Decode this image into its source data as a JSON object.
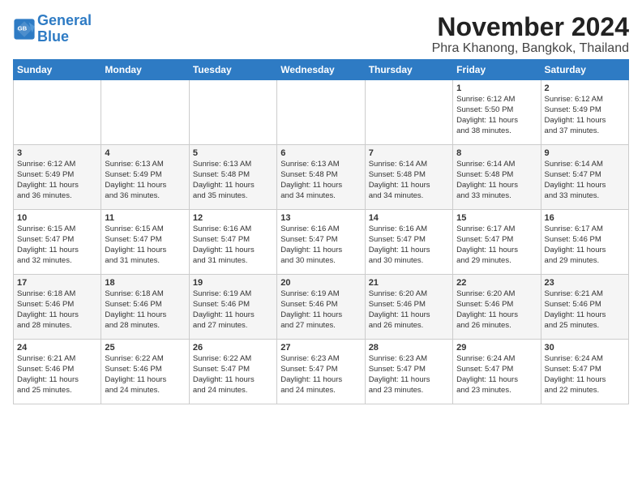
{
  "header": {
    "logo_line1": "General",
    "logo_line2": "Blue",
    "month_title": "November 2024",
    "location": "Phra Khanong, Bangkok, Thailand"
  },
  "weekdays": [
    "Sunday",
    "Monday",
    "Tuesday",
    "Wednesday",
    "Thursday",
    "Friday",
    "Saturday"
  ],
  "weeks": [
    [
      {
        "day": "",
        "info": ""
      },
      {
        "day": "",
        "info": ""
      },
      {
        "day": "",
        "info": ""
      },
      {
        "day": "",
        "info": ""
      },
      {
        "day": "",
        "info": ""
      },
      {
        "day": "1",
        "info": "Sunrise: 6:12 AM\nSunset: 5:50 PM\nDaylight: 11 hours\nand 38 minutes."
      },
      {
        "day": "2",
        "info": "Sunrise: 6:12 AM\nSunset: 5:49 PM\nDaylight: 11 hours\nand 37 minutes."
      }
    ],
    [
      {
        "day": "3",
        "info": "Sunrise: 6:12 AM\nSunset: 5:49 PM\nDaylight: 11 hours\nand 36 minutes."
      },
      {
        "day": "4",
        "info": "Sunrise: 6:13 AM\nSunset: 5:49 PM\nDaylight: 11 hours\nand 36 minutes."
      },
      {
        "day": "5",
        "info": "Sunrise: 6:13 AM\nSunset: 5:48 PM\nDaylight: 11 hours\nand 35 minutes."
      },
      {
        "day": "6",
        "info": "Sunrise: 6:13 AM\nSunset: 5:48 PM\nDaylight: 11 hours\nand 34 minutes."
      },
      {
        "day": "7",
        "info": "Sunrise: 6:14 AM\nSunset: 5:48 PM\nDaylight: 11 hours\nand 34 minutes."
      },
      {
        "day": "8",
        "info": "Sunrise: 6:14 AM\nSunset: 5:48 PM\nDaylight: 11 hours\nand 33 minutes."
      },
      {
        "day": "9",
        "info": "Sunrise: 6:14 AM\nSunset: 5:47 PM\nDaylight: 11 hours\nand 33 minutes."
      }
    ],
    [
      {
        "day": "10",
        "info": "Sunrise: 6:15 AM\nSunset: 5:47 PM\nDaylight: 11 hours\nand 32 minutes."
      },
      {
        "day": "11",
        "info": "Sunrise: 6:15 AM\nSunset: 5:47 PM\nDaylight: 11 hours\nand 31 minutes."
      },
      {
        "day": "12",
        "info": "Sunrise: 6:16 AM\nSunset: 5:47 PM\nDaylight: 11 hours\nand 31 minutes."
      },
      {
        "day": "13",
        "info": "Sunrise: 6:16 AM\nSunset: 5:47 PM\nDaylight: 11 hours\nand 30 minutes."
      },
      {
        "day": "14",
        "info": "Sunrise: 6:16 AM\nSunset: 5:47 PM\nDaylight: 11 hours\nand 30 minutes."
      },
      {
        "day": "15",
        "info": "Sunrise: 6:17 AM\nSunset: 5:47 PM\nDaylight: 11 hours\nand 29 minutes."
      },
      {
        "day": "16",
        "info": "Sunrise: 6:17 AM\nSunset: 5:46 PM\nDaylight: 11 hours\nand 29 minutes."
      }
    ],
    [
      {
        "day": "17",
        "info": "Sunrise: 6:18 AM\nSunset: 5:46 PM\nDaylight: 11 hours\nand 28 minutes."
      },
      {
        "day": "18",
        "info": "Sunrise: 6:18 AM\nSunset: 5:46 PM\nDaylight: 11 hours\nand 28 minutes."
      },
      {
        "day": "19",
        "info": "Sunrise: 6:19 AM\nSunset: 5:46 PM\nDaylight: 11 hours\nand 27 minutes."
      },
      {
        "day": "20",
        "info": "Sunrise: 6:19 AM\nSunset: 5:46 PM\nDaylight: 11 hours\nand 27 minutes."
      },
      {
        "day": "21",
        "info": "Sunrise: 6:20 AM\nSunset: 5:46 PM\nDaylight: 11 hours\nand 26 minutes."
      },
      {
        "day": "22",
        "info": "Sunrise: 6:20 AM\nSunset: 5:46 PM\nDaylight: 11 hours\nand 26 minutes."
      },
      {
        "day": "23",
        "info": "Sunrise: 6:21 AM\nSunset: 5:46 PM\nDaylight: 11 hours\nand 25 minutes."
      }
    ],
    [
      {
        "day": "24",
        "info": "Sunrise: 6:21 AM\nSunset: 5:46 PM\nDaylight: 11 hours\nand 25 minutes."
      },
      {
        "day": "25",
        "info": "Sunrise: 6:22 AM\nSunset: 5:46 PM\nDaylight: 11 hours\nand 24 minutes."
      },
      {
        "day": "26",
        "info": "Sunrise: 6:22 AM\nSunset: 5:47 PM\nDaylight: 11 hours\nand 24 minutes."
      },
      {
        "day": "27",
        "info": "Sunrise: 6:23 AM\nSunset: 5:47 PM\nDaylight: 11 hours\nand 24 minutes."
      },
      {
        "day": "28",
        "info": "Sunrise: 6:23 AM\nSunset: 5:47 PM\nDaylight: 11 hours\nand 23 minutes."
      },
      {
        "day": "29",
        "info": "Sunrise: 6:24 AM\nSunset: 5:47 PM\nDaylight: 11 hours\nand 23 minutes."
      },
      {
        "day": "30",
        "info": "Sunrise: 6:24 AM\nSunset: 5:47 PM\nDaylight: 11 hours\nand 22 minutes."
      }
    ]
  ]
}
